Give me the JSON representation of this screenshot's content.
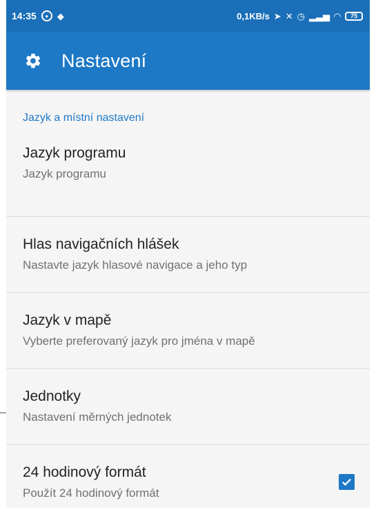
{
  "status_bar": {
    "time": "14:35",
    "net_speed": "0,1KB/s",
    "battery": "75",
    "icons": [
      "notification-circle-icon",
      "location-badge-icon",
      "send-icon",
      "mute-icon",
      "alarm-icon",
      "signal-icon",
      "wifi-icon",
      "battery-icon"
    ]
  },
  "app_bar": {
    "title": "Nastavení",
    "icon": "gear-icon"
  },
  "colors": {
    "primary": "#1d78c5",
    "status_bar": "#1a6fb8",
    "category_text": "#1d78c5"
  },
  "section": {
    "header": "Jazyk a místní nastavení",
    "items": [
      {
        "title": "Jazyk programu",
        "subtitle": "Jazyk programu"
      },
      {
        "title": "Hlas navigačních hlášek",
        "subtitle": "Nastavte jazyk hlasové navigace a jeho typ"
      },
      {
        "title": "Jazyk v mapě",
        "subtitle": "Vyberte preferovaný jazyk pro jména v mapě"
      },
      {
        "title": "Jednotky",
        "subtitle": "Nastavení měrných jednotek"
      },
      {
        "title": "24 hodinový formát",
        "subtitle": "Použít 24 hodinový formát",
        "checked": true
      }
    ]
  }
}
